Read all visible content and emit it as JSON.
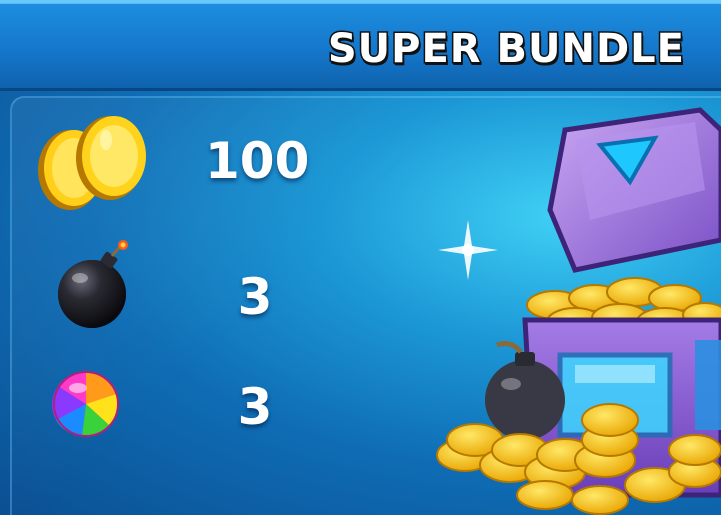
{
  "bundle": {
    "title": "SUPER BUNDLE",
    "items": [
      {
        "icon": "coins-icon",
        "quantity": "100"
      },
      {
        "icon": "bomb-icon",
        "quantity": "3"
      },
      {
        "icon": "rainbow-candy-icon",
        "quantity": "3"
      }
    ],
    "art": "treasure-chest-icon"
  },
  "colors": {
    "header": "#1578cc",
    "background": "#1c98d6",
    "title_text": "#ffffff",
    "coin": "#ffcf1a",
    "chest": "#8a5fd0"
  }
}
